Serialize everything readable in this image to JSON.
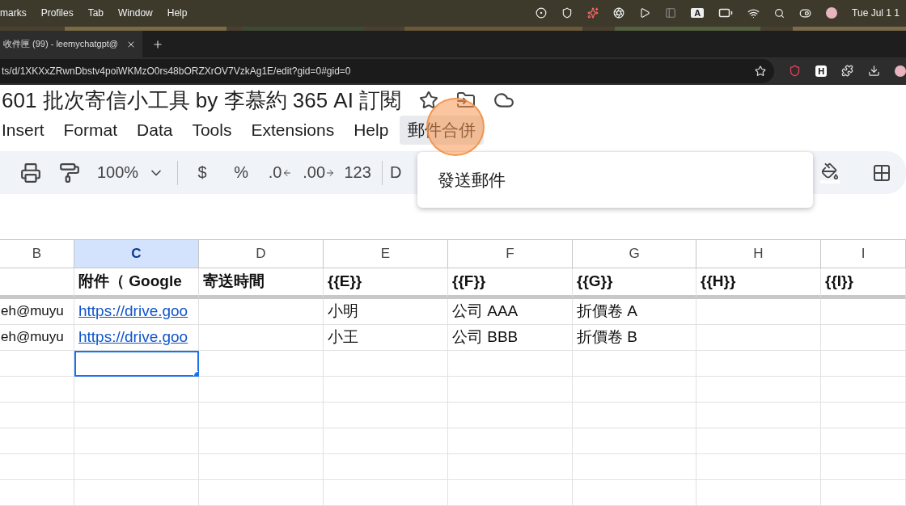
{
  "menubar": {
    "items": [
      "marks",
      "Profiles",
      "Tab",
      "Window",
      "Help"
    ],
    "input_source": "A",
    "clock": "Tue Jul 1 1"
  },
  "tabs": [
    {
      "title": "收件匣 (99) - leemychatgpt@",
      "selected": true
    }
  ],
  "address_bar": {
    "url": "ts/d/1XKXxZRwnDbstv4poiWKMzO0rs48bORZXrOV7VzkAg1E/edit?gid=0#gid=0"
  },
  "extension_badge": "H",
  "doc": {
    "title": "601 批次寄信小工具 by 李慕約 365 AI 訂閱"
  },
  "menu": [
    {
      "label": "Insert",
      "selected": false
    },
    {
      "label": "Format",
      "selected": false
    },
    {
      "label": "Data",
      "selected": false
    },
    {
      "label": "Tools",
      "selected": false
    },
    {
      "label": "Extensions",
      "selected": false
    },
    {
      "label": "Help",
      "selected": false
    },
    {
      "label": "郵件合併",
      "selected": true
    }
  ],
  "dropdown": {
    "items": [
      "發送郵件"
    ]
  },
  "click_marker": {
    "shown": true
  },
  "toolbar": {
    "zoom": "100%",
    "currency": "$",
    "percent": "%",
    "decrease_decimals": ".0",
    "increase_decimals": ".00",
    "number_format": "123",
    "font": "D"
  },
  "sheet": {
    "columns": [
      {
        "label": "B",
        "selected": false
      },
      {
        "label": "C",
        "selected": true
      },
      {
        "label": "D",
        "selected": false
      },
      {
        "label": "E",
        "selected": false
      },
      {
        "label": "F",
        "selected": false
      },
      {
        "label": "G",
        "selected": false
      },
      {
        "label": "H",
        "selected": false
      },
      {
        "label": "I",
        "selected": false
      }
    ],
    "rows": [
      {
        "kind": "header",
        "cells": [
          {
            "selected": false
          },
          {
            "text": "附件（ Google",
            "selected": false
          },
          {
            "text": "寄送時間",
            "selected": false
          },
          {
            "text": "{{E}}",
            "selected": false
          },
          {
            "text": "{{F}}",
            "selected": false
          },
          {
            "text": "{{G}}",
            "selected": false
          },
          {
            "text": "{{H}}",
            "selected": false
          },
          {
            "text": "{{I}}",
            "selected": false
          }
        ]
      },
      {
        "kind": "data",
        "cells": [
          {
            "text": "eh@muyu",
            "selected": false
          },
          {
            "text": "https://drive.goo",
            "link": true,
            "selected": false
          },
          {
            "selected": false
          },
          {
            "text": "小明",
            "selected": false
          },
          {
            "text": "公司 AAA",
            "selected": false
          },
          {
            "text": "折價卷 A",
            "selected": false
          },
          {
            "selected": false
          },
          {
            "selected": false
          }
        ]
      },
      {
        "kind": "data",
        "cells": [
          {
            "text": "eh@muyu",
            "selected": false
          },
          {
            "text": "https://drive.goo",
            "link": true,
            "selected": false
          },
          {
            "selected": false
          },
          {
            "text": "小王",
            "selected": false
          },
          {
            "text": "公司 BBB",
            "selected": false
          },
          {
            "text": "折價卷 B",
            "selected": false
          },
          {
            "selected": false
          },
          {
            "selected": false
          }
        ]
      },
      {
        "kind": "data",
        "cells": [
          {
            "selected": false
          },
          {
            "selected": true
          },
          {
            "selected": false
          },
          {
            "selected": false
          },
          {
            "selected": false
          },
          {
            "selected": false
          },
          {
            "selected": false
          },
          {
            "selected": false
          }
        ]
      },
      {
        "kind": "data",
        "cells": [
          {
            "selected": false
          },
          {
            "selected": false
          },
          {
            "selected": false
          },
          {
            "selected": false
          },
          {
            "selected": false
          },
          {
            "selected": false
          },
          {
            "selected": false
          },
          {
            "selected": false
          }
        ]
      },
      {
        "kind": "data",
        "cells": [
          {
            "selected": false
          },
          {
            "selected": false
          },
          {
            "selected": false
          },
          {
            "selected": false
          },
          {
            "selected": false
          },
          {
            "selected": false
          },
          {
            "selected": false
          },
          {
            "selected": false
          }
        ]
      },
      {
        "kind": "data",
        "cells": [
          {
            "selected": false
          },
          {
            "selected": false
          },
          {
            "selected": false
          },
          {
            "selected": false
          },
          {
            "selected": false
          },
          {
            "selected": false
          },
          {
            "selected": false
          },
          {
            "selected": false
          }
        ]
      },
      {
        "kind": "data",
        "cells": [
          {
            "selected": false
          },
          {
            "selected": false
          },
          {
            "selected": false
          },
          {
            "selected": false
          },
          {
            "selected": false
          },
          {
            "selected": false
          },
          {
            "selected": false
          },
          {
            "selected": false
          }
        ]
      },
      {
        "kind": "data",
        "cells": [
          {
            "selected": false
          },
          {
            "selected": false
          },
          {
            "selected": false
          },
          {
            "selected": false
          },
          {
            "selected": false
          },
          {
            "selected": false
          },
          {
            "selected": false
          },
          {
            "selected": false
          }
        ]
      }
    ]
  }
}
